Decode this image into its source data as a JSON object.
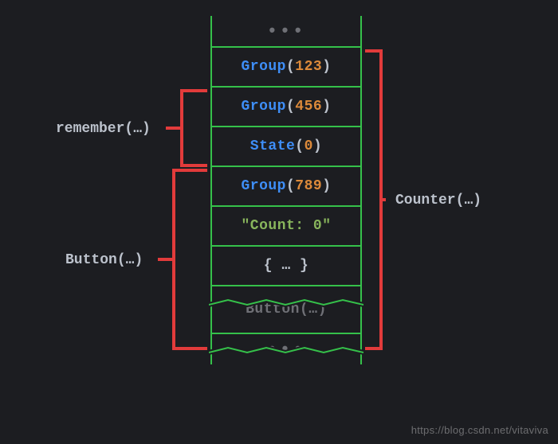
{
  "stack": {
    "cells": [
      {
        "type": "ellipsis"
      },
      {
        "fn": "Group",
        "arg": "123",
        "argColor": "num"
      },
      {
        "fn": "Group",
        "arg": "456",
        "argColor": "num"
      },
      {
        "fn": "State",
        "arg": "0",
        "argColor": "num"
      },
      {
        "fn": "Group",
        "arg": "789",
        "argColor": "num"
      },
      {
        "str": "\"Count: 0\""
      },
      {
        "body": "{ … }"
      },
      {
        "gapFn": "Button",
        "gapArg": "…"
      },
      {
        "type": "ellipsis"
      }
    ]
  },
  "labels": {
    "remember": {
      "fn": "remember",
      "arg": "…"
    },
    "counter": {
      "fn": "Counter",
      "arg": "…"
    },
    "button": {
      "fn": "Button",
      "arg": "…"
    }
  },
  "colors": {
    "bg": "#1c1d21",
    "border": "#35c14a",
    "bracket": "#e23b3b",
    "fn": "#3e8ef7",
    "num": "#dd8a3a",
    "str": "#88b55c",
    "text": "#bcc2cc",
    "faded": "#6f7076"
  },
  "watermark": "https://blog.csdn.net/vitaviva"
}
